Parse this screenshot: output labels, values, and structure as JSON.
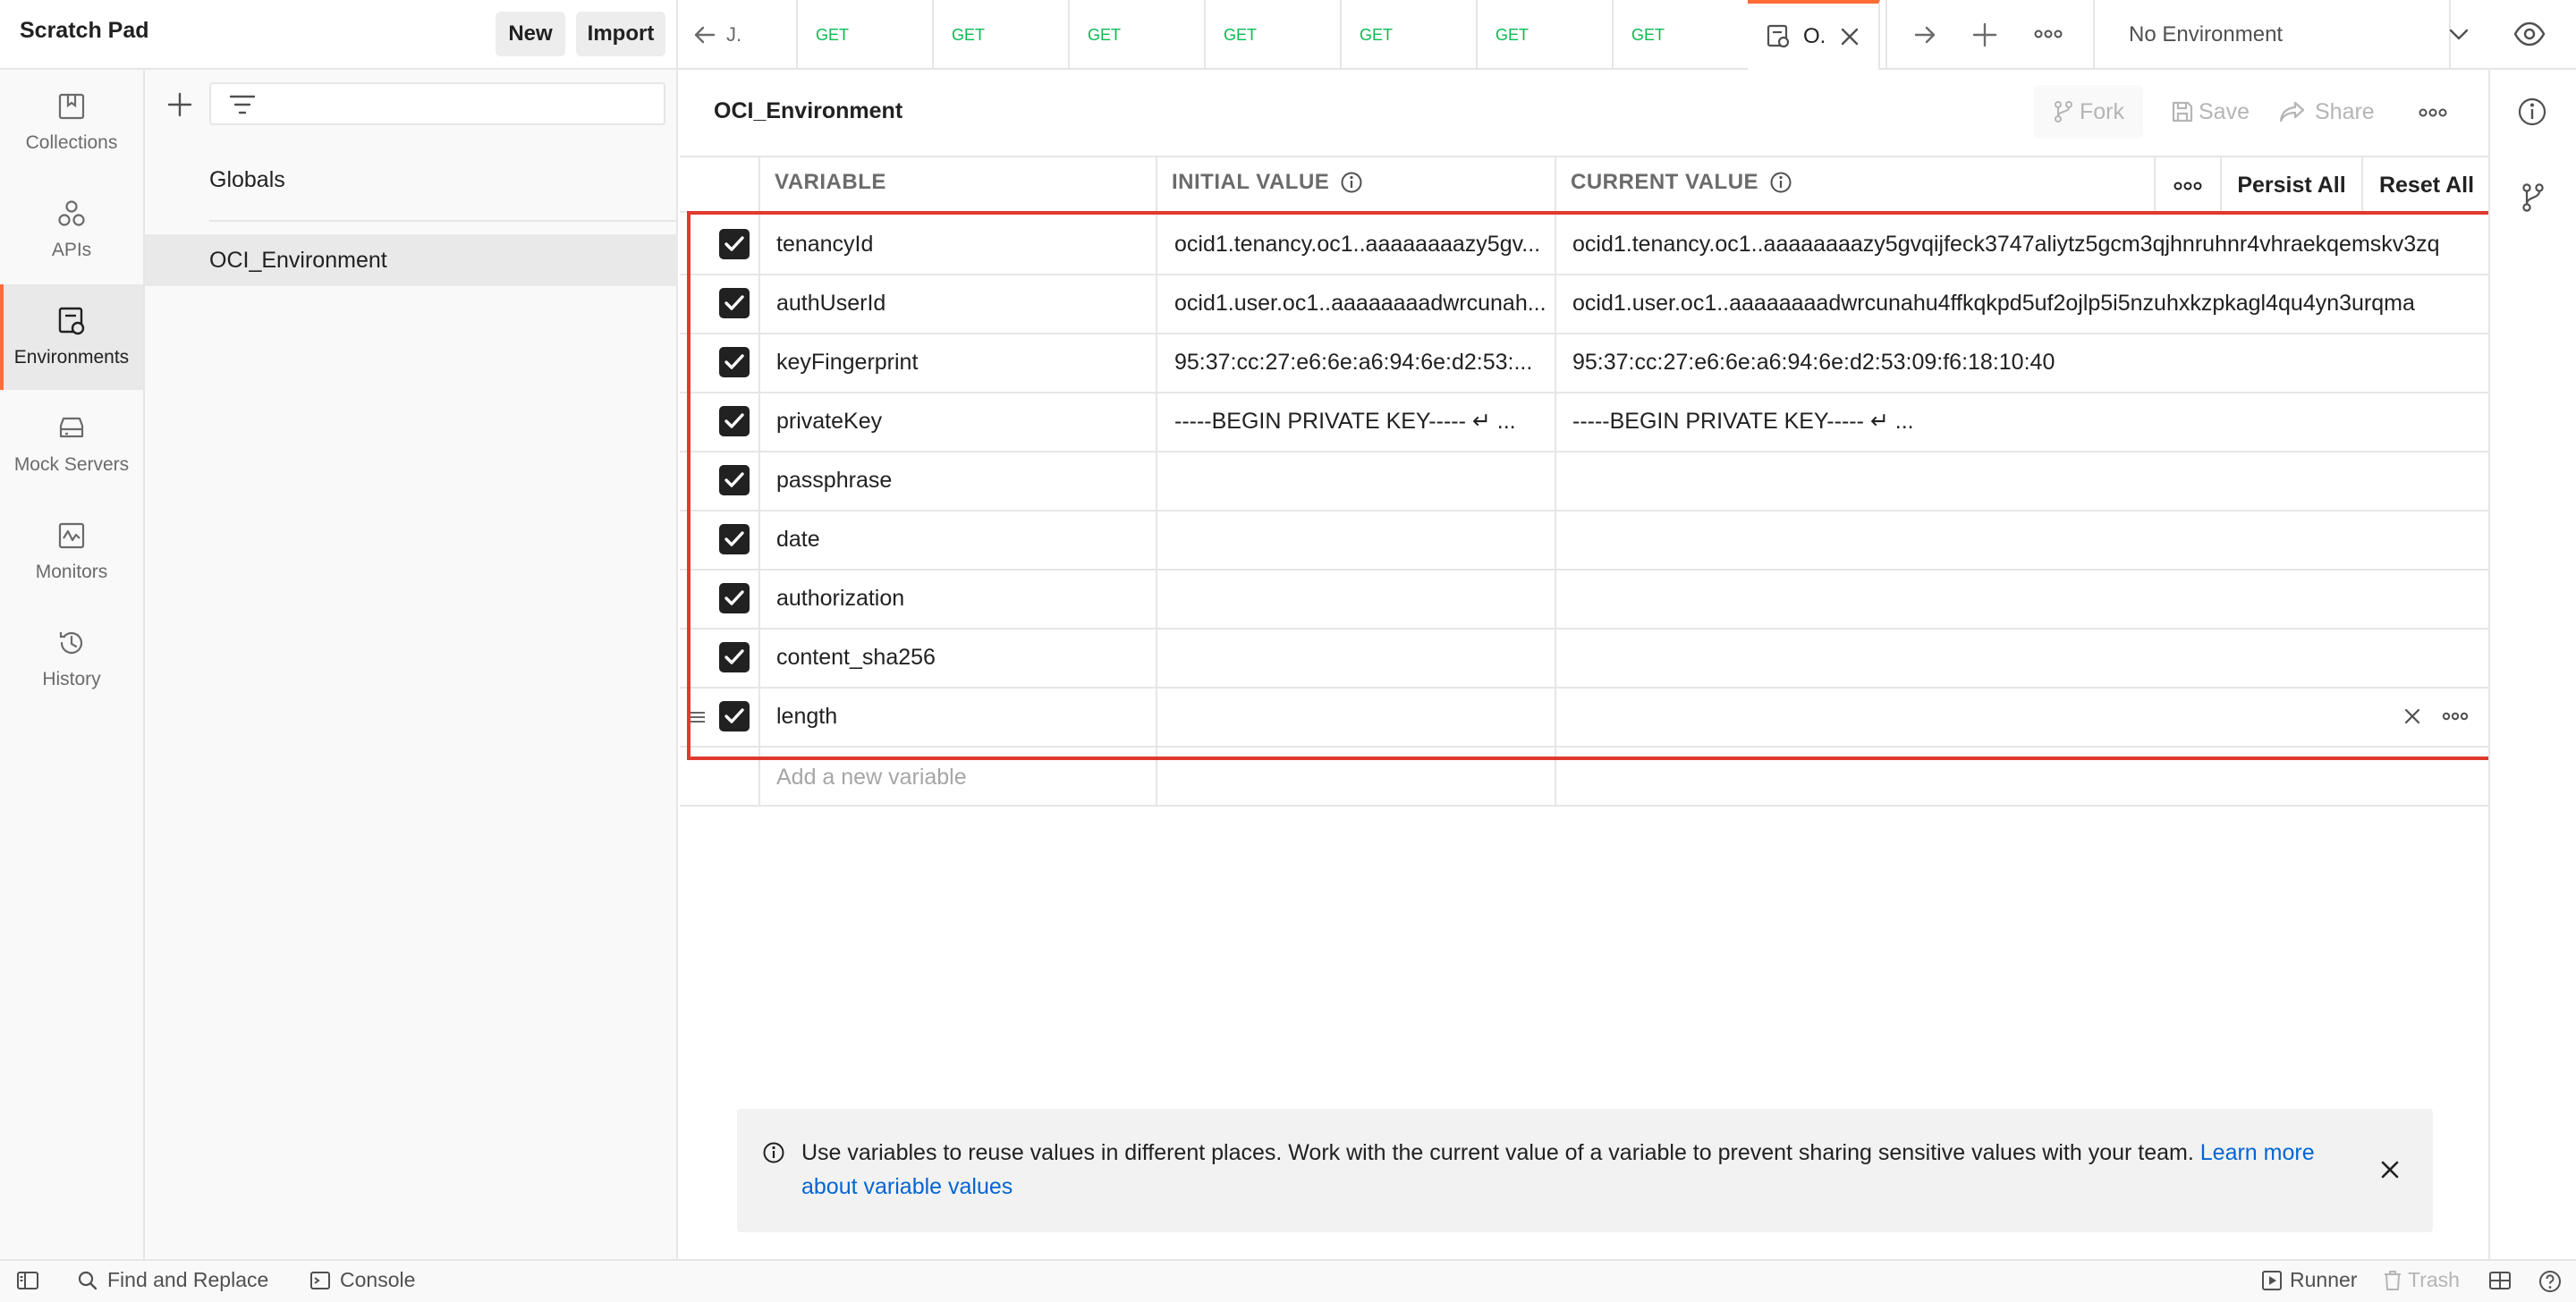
{
  "header": {
    "workspace_title": "Scratch Pad",
    "new_label": "New",
    "import_label": "Import",
    "tabs": [
      {
        "label": "J."
      },
      {
        "method": "GET"
      },
      {
        "method": "GET"
      },
      {
        "method": "GET"
      },
      {
        "method": "GET"
      },
      {
        "method": "GET"
      },
      {
        "method": "GET"
      },
      {
        "method": "GET"
      },
      {
        "label": "O."
      }
    ],
    "environment": "No Environment",
    "accent": "#ff6c37"
  },
  "sidebar": {
    "items": [
      {
        "label": "Collections",
        "icon": "collections-icon"
      },
      {
        "label": "APIs",
        "icon": "apis-icon"
      },
      {
        "label": "Environments",
        "icon": "environments-icon"
      },
      {
        "label": "Mock Servers",
        "icon": "mock-servers-icon"
      },
      {
        "label": "Monitors",
        "icon": "monitors-icon"
      },
      {
        "label": "History",
        "icon": "history-icon"
      }
    ],
    "active": "Environments"
  },
  "envlist": {
    "search_placeholder": "",
    "items": [
      "Globals",
      "OCI_Environment"
    ],
    "selected": "OCI_Environment"
  },
  "main": {
    "title": "OCI_Environment",
    "fork_label": "Fork",
    "save_label": "Save",
    "share_label": "Share",
    "columns": {
      "variable": "VARIABLE",
      "initial": "INITIAL VALUE",
      "current": "CURRENT VALUE"
    },
    "persist_all_label": "Persist All",
    "reset_all_label": "Reset All",
    "rows": [
      {
        "variable": "tenancyId",
        "initial": "ocid1.tenancy.oc1..aaaaaaaazy5gv...",
        "current": "ocid1.tenancy.oc1..aaaaaaaazy5gvqijfeck3747aliytz5gcm3qjhnruhnr4vhraekqemskv3zq"
      },
      {
        "variable": "authUserId",
        "initial": "ocid1.user.oc1..aaaaaaaadwrcunah...",
        "current": "ocid1.user.oc1..aaaaaaaadwrcunahu4ffkqkpd5uf2ojlp5i5nzuhxkzpkagl4qu4yn3urqma"
      },
      {
        "variable": "keyFingerprint",
        "initial": "95:37:cc:27:e6:6e:a6:94:6e:d2:53:...",
        "current": "95:37:cc:27:e6:6e:a6:94:6e:d2:53:09:f6:18:10:40"
      },
      {
        "variable": "privateKey",
        "initial": "-----BEGIN PRIVATE KEY----- ↵ ...",
        "current": "-----BEGIN PRIVATE KEY----- ↵ ..."
      },
      {
        "variable": "passphrase",
        "initial": "",
        "current": ""
      },
      {
        "variable": "date",
        "initial": "",
        "current": ""
      },
      {
        "variable": "authorization",
        "initial": "",
        "current": ""
      },
      {
        "variable": "content_sha256",
        "initial": "",
        "current": ""
      },
      {
        "variable": "length",
        "initial": "",
        "current": ""
      }
    ],
    "add_placeholder": "Add a new variable",
    "banner_text": "Use variables to reuse values in different places. Work with the current value of a variable to prevent sharing sensitive values with your team.",
    "banner_link": "Learn more about variable values"
  },
  "footer": {
    "find_replace": "Find and Replace",
    "console": "Console",
    "runner": "Runner",
    "trash": "Trash"
  }
}
